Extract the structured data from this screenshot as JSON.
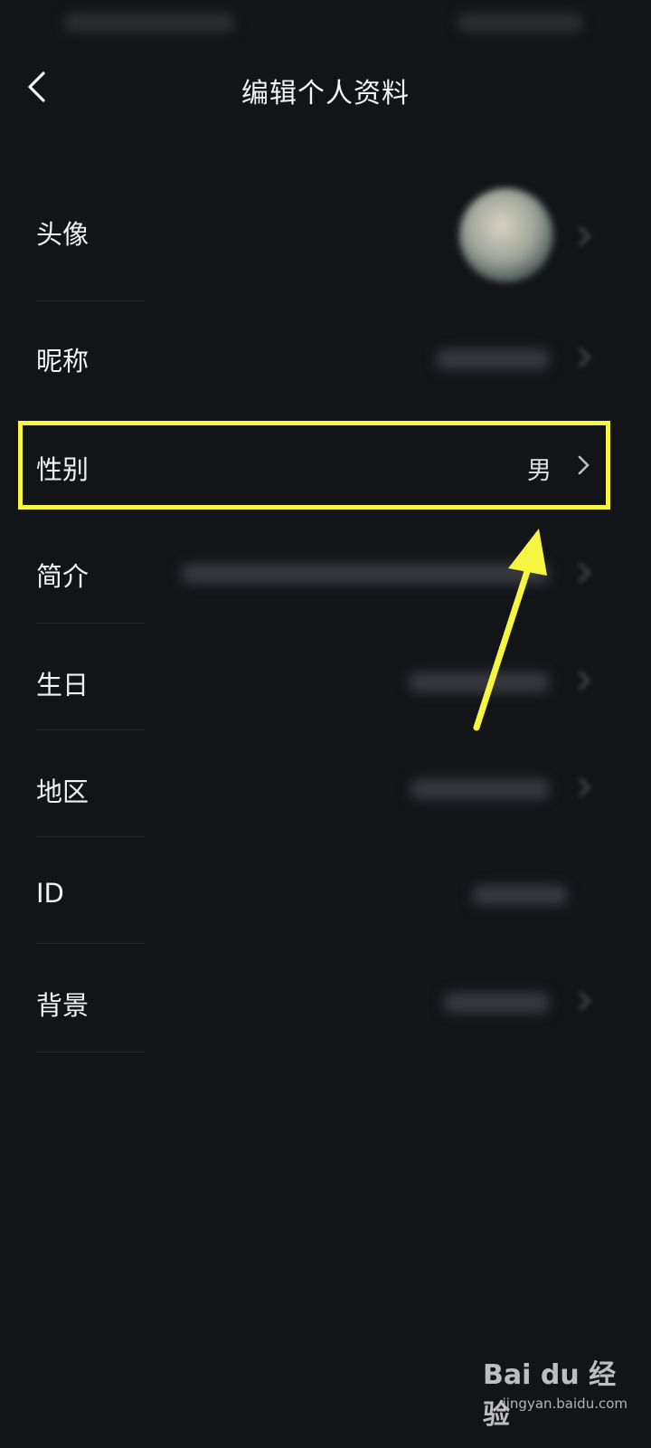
{
  "header": {
    "title": "编辑个人资料"
  },
  "rows": [
    {
      "label": "头像"
    },
    {
      "label": "昵称"
    },
    {
      "label": "性别",
      "value": "男"
    },
    {
      "label": "简介"
    },
    {
      "label": "生日"
    },
    {
      "label": "地区"
    },
    {
      "label": "ID"
    },
    {
      "label": "背景"
    }
  ],
  "watermark": {
    "logo": "Bai du 经验",
    "url": "jingyan.baidu.com"
  },
  "colors": {
    "background": "#131418",
    "highlight": "#f5f542",
    "text": "#f2f2f2"
  },
  "icons": {
    "back": "chevron-left-icon",
    "row_arrow": "chevron-right-icon",
    "annotation": "arrow-annotation-icon"
  }
}
